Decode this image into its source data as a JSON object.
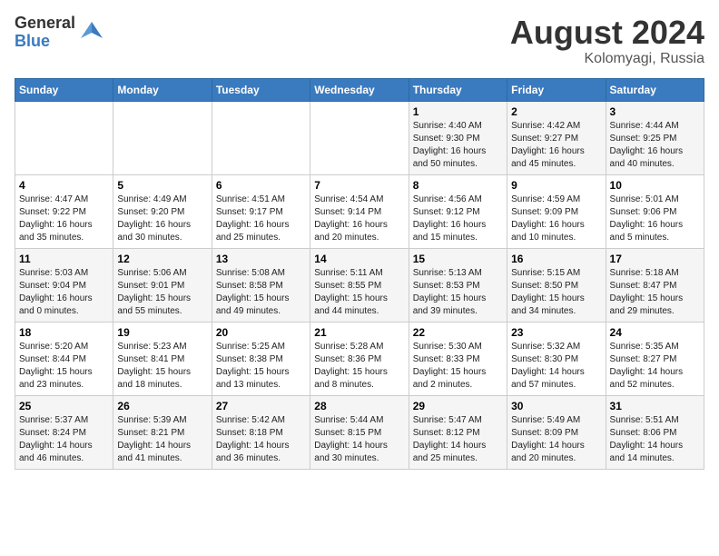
{
  "header": {
    "logo_general": "General",
    "logo_blue": "Blue",
    "month_year": "August 2024",
    "location": "Kolomyagi, Russia"
  },
  "weekdays": [
    "Sunday",
    "Monday",
    "Tuesday",
    "Wednesday",
    "Thursday",
    "Friday",
    "Saturday"
  ],
  "weeks": [
    [
      {
        "day": "",
        "info": ""
      },
      {
        "day": "",
        "info": ""
      },
      {
        "day": "",
        "info": ""
      },
      {
        "day": "",
        "info": ""
      },
      {
        "day": "1",
        "info": "Sunrise: 4:40 AM\nSunset: 9:30 PM\nDaylight: 16 hours\nand 50 minutes."
      },
      {
        "day": "2",
        "info": "Sunrise: 4:42 AM\nSunset: 9:27 PM\nDaylight: 16 hours\nand 45 minutes."
      },
      {
        "day": "3",
        "info": "Sunrise: 4:44 AM\nSunset: 9:25 PM\nDaylight: 16 hours\nand 40 minutes."
      }
    ],
    [
      {
        "day": "4",
        "info": "Sunrise: 4:47 AM\nSunset: 9:22 PM\nDaylight: 16 hours\nand 35 minutes."
      },
      {
        "day": "5",
        "info": "Sunrise: 4:49 AM\nSunset: 9:20 PM\nDaylight: 16 hours\nand 30 minutes."
      },
      {
        "day": "6",
        "info": "Sunrise: 4:51 AM\nSunset: 9:17 PM\nDaylight: 16 hours\nand 25 minutes."
      },
      {
        "day": "7",
        "info": "Sunrise: 4:54 AM\nSunset: 9:14 PM\nDaylight: 16 hours\nand 20 minutes."
      },
      {
        "day": "8",
        "info": "Sunrise: 4:56 AM\nSunset: 9:12 PM\nDaylight: 16 hours\nand 15 minutes."
      },
      {
        "day": "9",
        "info": "Sunrise: 4:59 AM\nSunset: 9:09 PM\nDaylight: 16 hours\nand 10 minutes."
      },
      {
        "day": "10",
        "info": "Sunrise: 5:01 AM\nSunset: 9:06 PM\nDaylight: 16 hours\nand 5 minutes."
      }
    ],
    [
      {
        "day": "11",
        "info": "Sunrise: 5:03 AM\nSunset: 9:04 PM\nDaylight: 16 hours\nand 0 minutes."
      },
      {
        "day": "12",
        "info": "Sunrise: 5:06 AM\nSunset: 9:01 PM\nDaylight: 15 hours\nand 55 minutes."
      },
      {
        "day": "13",
        "info": "Sunrise: 5:08 AM\nSunset: 8:58 PM\nDaylight: 15 hours\nand 49 minutes."
      },
      {
        "day": "14",
        "info": "Sunrise: 5:11 AM\nSunset: 8:55 PM\nDaylight: 15 hours\nand 44 minutes."
      },
      {
        "day": "15",
        "info": "Sunrise: 5:13 AM\nSunset: 8:53 PM\nDaylight: 15 hours\nand 39 minutes."
      },
      {
        "day": "16",
        "info": "Sunrise: 5:15 AM\nSunset: 8:50 PM\nDaylight: 15 hours\nand 34 minutes."
      },
      {
        "day": "17",
        "info": "Sunrise: 5:18 AM\nSunset: 8:47 PM\nDaylight: 15 hours\nand 29 minutes."
      }
    ],
    [
      {
        "day": "18",
        "info": "Sunrise: 5:20 AM\nSunset: 8:44 PM\nDaylight: 15 hours\nand 23 minutes."
      },
      {
        "day": "19",
        "info": "Sunrise: 5:23 AM\nSunset: 8:41 PM\nDaylight: 15 hours\nand 18 minutes."
      },
      {
        "day": "20",
        "info": "Sunrise: 5:25 AM\nSunset: 8:38 PM\nDaylight: 15 hours\nand 13 minutes."
      },
      {
        "day": "21",
        "info": "Sunrise: 5:28 AM\nSunset: 8:36 PM\nDaylight: 15 hours\nand 8 minutes."
      },
      {
        "day": "22",
        "info": "Sunrise: 5:30 AM\nSunset: 8:33 PM\nDaylight: 15 hours\nand 2 minutes."
      },
      {
        "day": "23",
        "info": "Sunrise: 5:32 AM\nSunset: 8:30 PM\nDaylight: 14 hours\nand 57 minutes."
      },
      {
        "day": "24",
        "info": "Sunrise: 5:35 AM\nSunset: 8:27 PM\nDaylight: 14 hours\nand 52 minutes."
      }
    ],
    [
      {
        "day": "25",
        "info": "Sunrise: 5:37 AM\nSunset: 8:24 PM\nDaylight: 14 hours\nand 46 minutes."
      },
      {
        "day": "26",
        "info": "Sunrise: 5:39 AM\nSunset: 8:21 PM\nDaylight: 14 hours\nand 41 minutes."
      },
      {
        "day": "27",
        "info": "Sunrise: 5:42 AM\nSunset: 8:18 PM\nDaylight: 14 hours\nand 36 minutes."
      },
      {
        "day": "28",
        "info": "Sunrise: 5:44 AM\nSunset: 8:15 PM\nDaylight: 14 hours\nand 30 minutes."
      },
      {
        "day": "29",
        "info": "Sunrise: 5:47 AM\nSunset: 8:12 PM\nDaylight: 14 hours\nand 25 minutes."
      },
      {
        "day": "30",
        "info": "Sunrise: 5:49 AM\nSunset: 8:09 PM\nDaylight: 14 hours\nand 20 minutes."
      },
      {
        "day": "31",
        "info": "Sunrise: 5:51 AM\nSunset: 8:06 PM\nDaylight: 14 hours\nand 14 minutes."
      }
    ]
  ]
}
